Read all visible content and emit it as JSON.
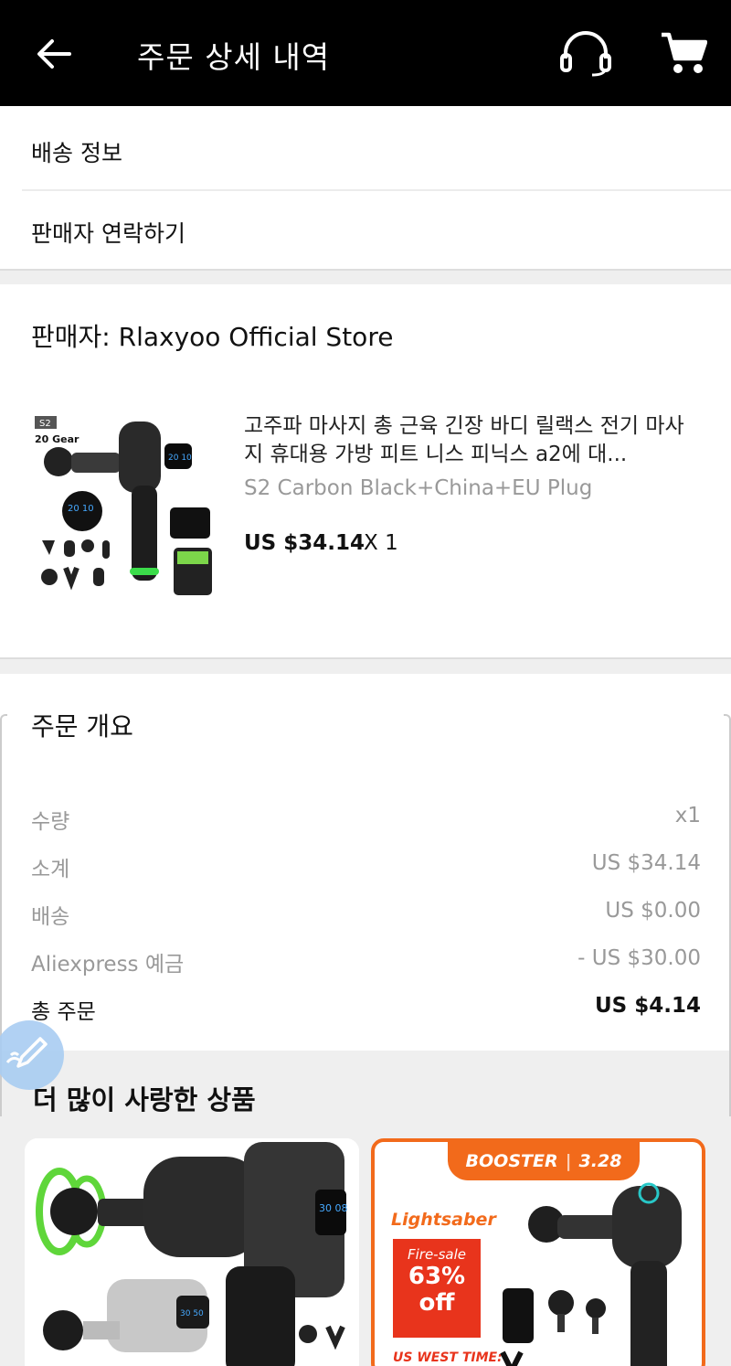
{
  "header": {
    "title": "주문 상세 내역",
    "back_icon": "arrow-left-icon",
    "support_icon": "headset-icon",
    "cart_icon": "cart-icon"
  },
  "menu": {
    "shipping_info": "배송 정보",
    "contact_seller": "판매자 연락하기"
  },
  "seller": {
    "label": "판매자: Rlaxyoo Official Store",
    "product": {
      "title": "고주파 마사지 총 근육 긴장 바디 릴랙스 전기 마사지 휴대용 가방 피트 니스 피닉스 a2에 대...",
      "variant": "S2 Carbon Black+China+EU Plug",
      "price": "US $34.14",
      "quantity": "X 1",
      "image_badge": "S2",
      "image_caption": "20 Gear",
      "image_display_1": "20 10",
      "image_display_2": "20 10"
    }
  },
  "summary": {
    "title": "주문 개요",
    "rows": [
      {
        "label": "수량",
        "value": "x1"
      },
      {
        "label": "소계",
        "value": "US $34.14"
      },
      {
        "label": "배송",
        "value": "US $0.00"
      },
      {
        "label": "Aliexpress 예금",
        "value": "- US $30.00"
      },
      {
        "label": "총 주문",
        "value": "US $4.14"
      }
    ]
  },
  "recommendations": {
    "title": "더 많이 사랑한 상품",
    "card1": {
      "display_1": "30 08",
      "display_2": "30 50"
    },
    "card2": {
      "brand": "BOOSTER",
      "date": "3.28",
      "line": "Lightsaber",
      "sale_label": "Fire-sale",
      "sale_percent": "63%",
      "sale_off": "off",
      "timer_label": "US WEST TIME:"
    }
  },
  "colors": {
    "header_bg": "#000000",
    "accent_orange": "#f26a1b",
    "sale_red": "#e8341c",
    "muted_text": "#999999"
  }
}
